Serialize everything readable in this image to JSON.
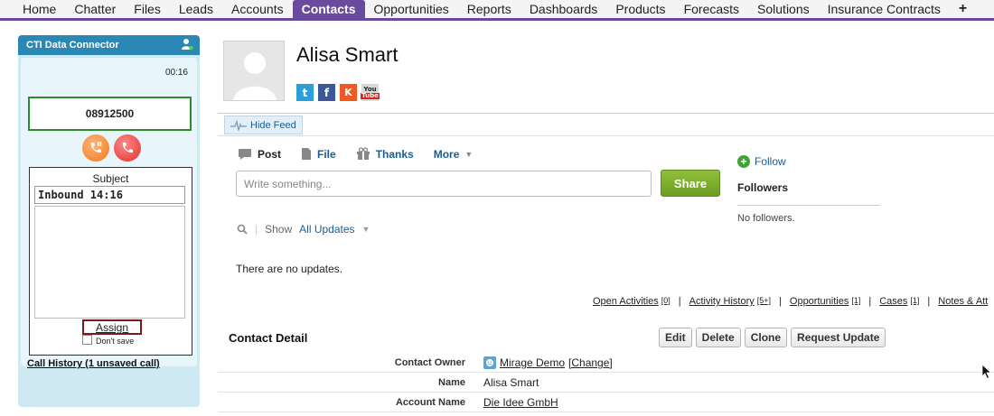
{
  "nav": {
    "tabs": [
      {
        "label": "Home"
      },
      {
        "label": "Chatter"
      },
      {
        "label": "Files"
      },
      {
        "label": "Leads"
      },
      {
        "label": "Accounts"
      },
      {
        "label": "Contacts"
      },
      {
        "label": "Opportunities"
      },
      {
        "label": "Reports"
      },
      {
        "label": "Dashboards"
      },
      {
        "label": "Products"
      },
      {
        "label": "Forecasts"
      },
      {
        "label": "Solutions"
      },
      {
        "label": "Insurance Contracts"
      }
    ],
    "active_tab": "Contacts",
    "more_label": "+"
  },
  "cti": {
    "title": "CTI Data Connector",
    "timer": "00:16",
    "phone_number": "08912500",
    "subject_label": "Subject",
    "subject_value": "Inbound 14:16",
    "assign_label": "Assign",
    "dont_save_label": "Don't save",
    "call_history_label": "Call History (1 unsaved call)",
    "colors": {
      "header": "#2b88b5",
      "panel": "#cfe9f3",
      "hold": "#f07a1a",
      "hangup": "#e0302a"
    }
  },
  "contact": {
    "name": "Alisa Smart",
    "social": [
      {
        "name": "twitter-icon",
        "glyph": "t"
      },
      {
        "name": "facebook-icon",
        "glyph": "f"
      },
      {
        "name": "klout-icon",
        "glyph": "K"
      }
    ],
    "youtube": {
      "you": "You",
      "tube": "Tube"
    }
  },
  "feed": {
    "hide_feed_label": "Hide Feed",
    "publisher": {
      "post": "Post",
      "file": "File",
      "thanks": "Thanks",
      "more": "More"
    },
    "placeholder": "Write something...",
    "share_label": "Share",
    "show_label": "Show",
    "filter_value": "All Updates",
    "empty_text": "There are no updates."
  },
  "followers": {
    "follow_label": "Follow",
    "title": "Followers",
    "empty_text": "No followers."
  },
  "related_links": [
    {
      "label": "Open Activities",
      "count": "[0]"
    },
    {
      "label": "Activity History",
      "count": "[5+]"
    },
    {
      "label": "Opportunities",
      "count": "[1]"
    },
    {
      "label": "Cases",
      "count": "[1]"
    },
    {
      "label": "Notes & Att",
      "count": ""
    }
  ],
  "detail": {
    "title": "Contact Detail",
    "buttons": {
      "edit": "Edit",
      "delete": "Delete",
      "clone": "Clone",
      "request_update": "Request Update"
    },
    "fields": {
      "owner_label": "Contact Owner",
      "owner_value": "Mirage Demo",
      "owner_change": "[Change]",
      "name_label": "Name",
      "name_value": "Alisa Smart",
      "account_label": "Account Name",
      "account_value": "Die Idee GmbH"
    }
  }
}
